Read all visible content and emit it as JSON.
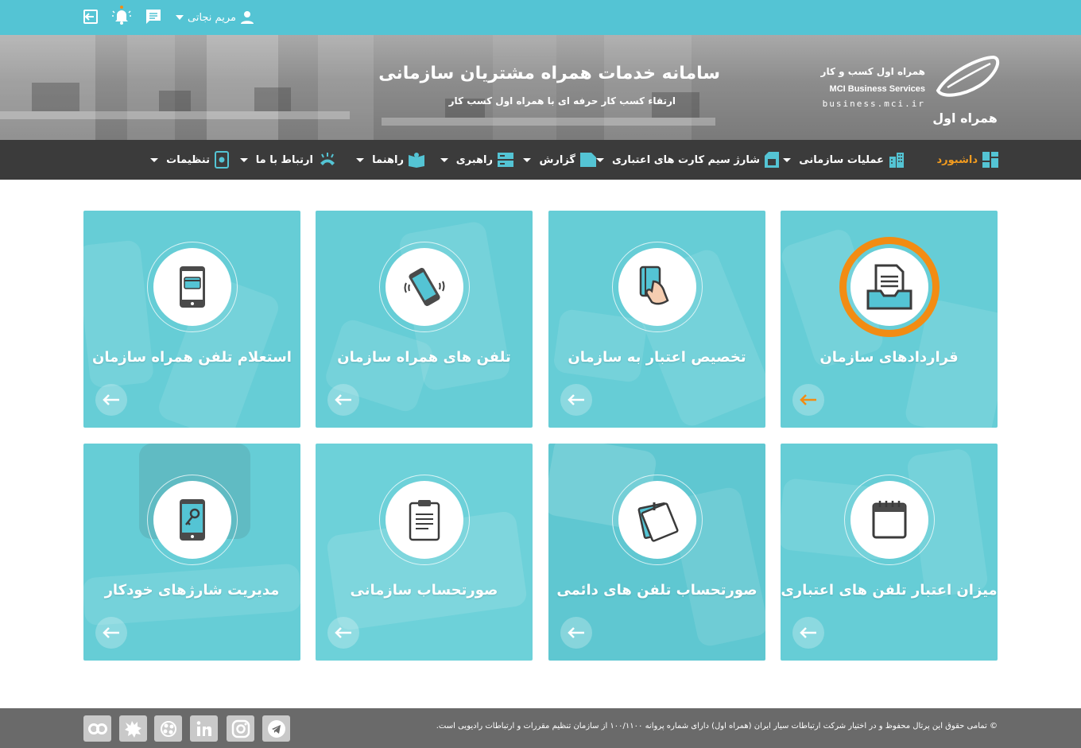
{
  "topbar": {
    "user_name": "مریم نجاتی",
    "icons": [
      "logout-icon",
      "notification-bell-icon",
      "messages-icon",
      "user-icon",
      "chevron-down-icon"
    ]
  },
  "header": {
    "title": "سامانه خدمات همراه مشتریان سازمانی",
    "subtitle": "ارتقاء کسب کار حرفه ای با همراه اول کسب کار",
    "brand_fa": "همراه اول کسب و کار",
    "brand_en": "MCI Business Services",
    "brand_url": "business.mci.ir",
    "logo_text": "همراه اول"
  },
  "nav": {
    "items": [
      {
        "label": "داشبورد",
        "icon": "dashboard-icon",
        "active": true
      },
      {
        "label": "عملیات سازمانی",
        "icon": "building-icon"
      },
      {
        "label": "شارژ سیم کارت های اعتباری",
        "icon": "sim-card-icon"
      },
      {
        "label": "گزارش",
        "icon": "report-icon"
      },
      {
        "label": "راهبری",
        "icon": "server-icon"
      },
      {
        "label": "راهنما",
        "icon": "guide-book-icon"
      },
      {
        "label": "ارتباط با ما",
        "icon": "contact-phone-icon"
      },
      {
        "label": "تنظیمات",
        "icon": "settings-device-icon"
      }
    ]
  },
  "cards": [
    {
      "title": "قراردادهای سازمان",
      "icon": "contracts-inbox-icon",
      "highlight": true
    },
    {
      "title": "تخصیص اعتبار به سازمان",
      "icon": "credit-card-hand-icon"
    },
    {
      "title": "تلفن های همراه سازمان",
      "icon": "vibrating-phone-icon"
    },
    {
      "title": "استعلام تلفن همراه سازمان",
      "icon": "phone-inquiry-icon"
    },
    {
      "title": "میزان اعتبار تلفن های اعتباری",
      "icon": "calendar-icon"
    },
    {
      "title": "صورتحساب تلفن های دائمی",
      "icon": "sticky-note-icon"
    },
    {
      "title": "صورتحساب سازمانی",
      "icon": "clipboard-icon"
    },
    {
      "title": "مدیریت شارژهای خودکار",
      "icon": "phone-key-icon"
    }
  ],
  "footer": {
    "copyright": "© تمامی حقوق این پرتال محفوظ و در اختیار شرکت ارتباطات سیار ایران (همراه اول) دارای شماره پروانه ۱۰۰/۱۱۰۰ از سازمان تنظیم مقررات و ارتباطات رادیویی است.",
    "social": [
      "telegram-icon",
      "instagram-icon",
      "linkedin-icon",
      "aparat-icon",
      "twitter-bird-icon",
      "cloob-icon"
    ]
  },
  "colors": {
    "primary": "#54c4d4",
    "card": "#66cdd6",
    "accent": "#f28c13",
    "nav_bg": "#3b3b3b",
    "footer_bg": "#6a6a6a"
  }
}
